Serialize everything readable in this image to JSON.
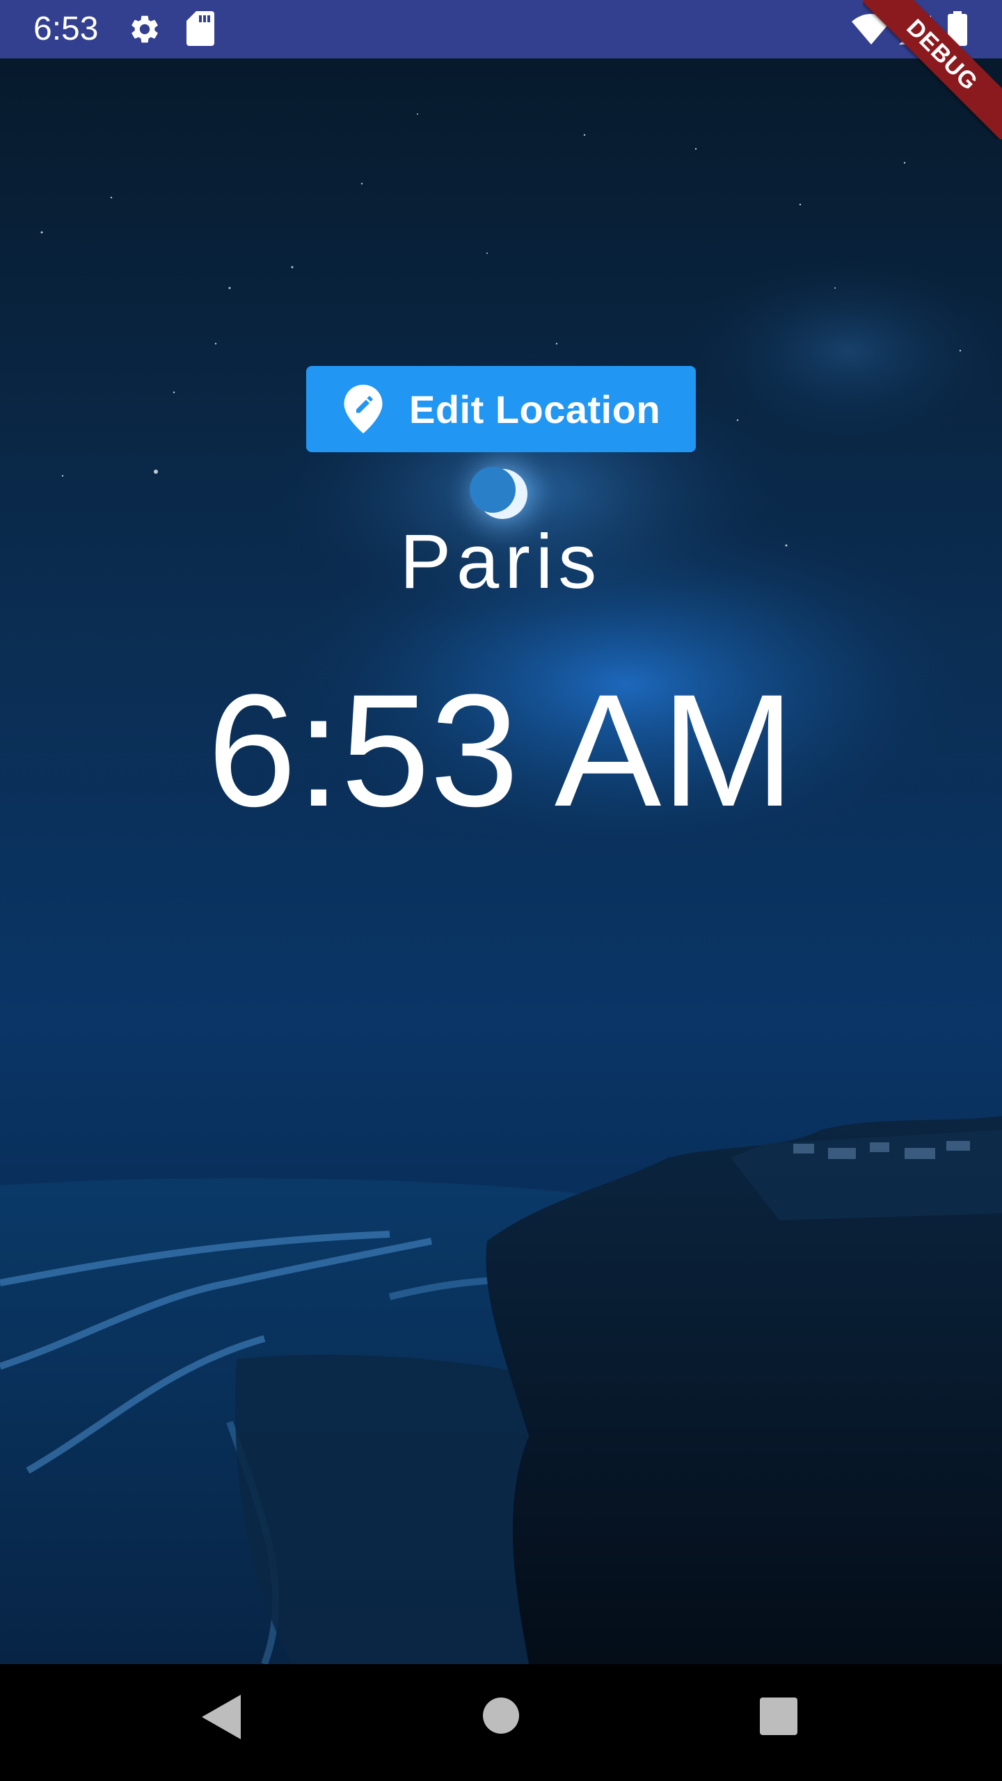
{
  "status_bar": {
    "time": "6:53",
    "background": "#333f8f",
    "icons": [
      "settings-icon",
      "sd-card-icon",
      "wifi-icon",
      "cell-signal-icon",
      "battery-icon"
    ]
  },
  "debug_banner": {
    "label": "DEBUG",
    "color": "#8b1a1f"
  },
  "main": {
    "edit_location_button": {
      "label": "Edit Location",
      "icon": "edit-location-icon",
      "color": "#2196f3"
    },
    "location": "Paris",
    "time": "6:53 AM",
    "daytime_icon": "moon"
  },
  "nav_bar": {
    "buttons": [
      "back-icon",
      "home-icon",
      "recents-icon"
    ]
  }
}
